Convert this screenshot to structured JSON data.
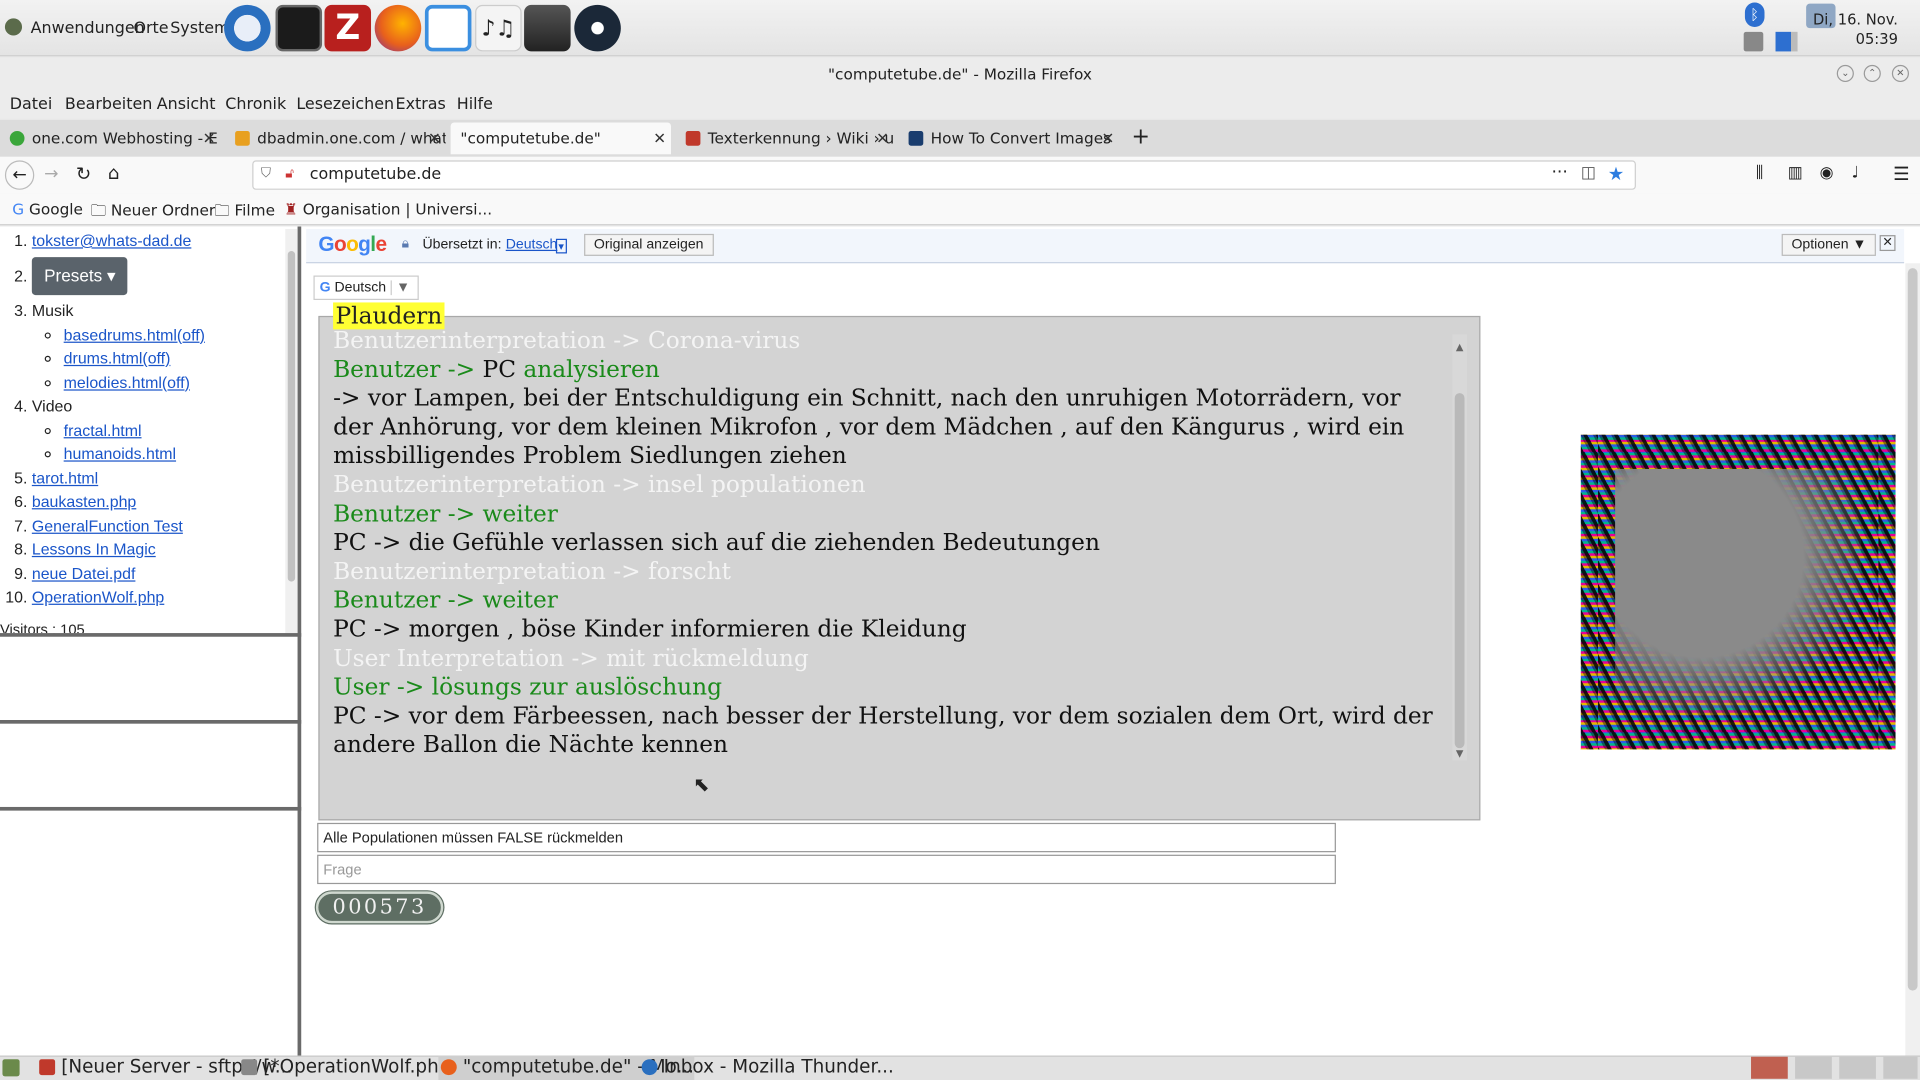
{
  "desktop_panel": {
    "menus": [
      "Anwendungen",
      "Orte",
      "System"
    ],
    "launchers": [
      "thunderbird-icon",
      "terminal-icon",
      "filezilla-icon",
      "firefox-icon",
      "media-player-icon",
      "music-notes-icon",
      "game-icon",
      "steam-icon"
    ],
    "clock_date": "Di, 16. Nov.",
    "clock_time": "05:39"
  },
  "window": {
    "title": "\"computetube.de\" - Mozilla Firefox"
  },
  "menubar": [
    "Datei",
    "Bearbeiten",
    "Ansicht",
    "Chronik",
    "Lesezeichen",
    "Extras",
    "Hilfe"
  ],
  "tabs": [
    {
      "label": "one.com Webhosting - E",
      "color": "#3aa63a"
    },
    {
      "label": "dbadmin.one.com / what",
      "color": "#e8a020"
    },
    {
      "label": "\"computetube.de\"",
      "color": ""
    },
    {
      "label": "Texterkennung › Wiki › ul",
      "color": "#c0392b"
    },
    {
      "label": "How To Convert Images",
      "color": "#1a3d6e"
    }
  ],
  "address": {
    "url": "computetube.de"
  },
  "bookmarks": [
    "Google",
    "Neuer Ordner",
    "Filme",
    "Organisation | Universi..."
  ],
  "sidebar": {
    "items": {
      "i1": "tokster@whats-dad.de",
      "presets": "Presets",
      "musik": "Musik",
      "basedrums": "basedrums.html(off)",
      "drums": "drums.html(off)",
      "melodies": "melodies.html(off)",
      "video": "Video",
      "fractal": "fractal.html",
      "humanoids": "humanoids.html",
      "tarot": "tarot.html",
      "baukasten": "baukasten.php",
      "generalfunction": "GeneralFunction Test",
      "lessons": "Lessons In Magic",
      "neuedatei": "neue Datei.pdf",
      "operationwolf": "OperationWolf.php"
    },
    "visitors": "Visitors : 105"
  },
  "translate_bar": {
    "translated_to_label": "Übersetzt in:",
    "language": "Deutsch",
    "show_original": "Original anzeigen",
    "options": "Optionen ▼",
    "lang_select": "Deutsch"
  },
  "chat": {
    "title": "Plaudern",
    "lines": {
      "l0": "Benutzerinterpretation -> Corona-virus",
      "l1a": "Benutzer -> ",
      "l1b": "PC",
      "l1c": " analysieren",
      "l2": "-> vor Lampen, bei der Entschuldigung ein Schnitt, nach den unruhigen Motorrädern, vor der Anhörung, vor dem kleinen Mikrofon , vor dem Mädchen , auf den Kängurus , wird ein missbilligendes Problem Siedlungen ziehen",
      "l3": "Benutzerinterpretation -> insel populationen",
      "l4": "Benutzer -> weiter",
      "l5": "PC -> die Gefühle verlassen sich auf die ziehenden Bedeutungen",
      "l6": "Benutzerinterpretation -> forscht",
      "l7": "Benutzer -> weiter",
      "l8": "PC -> morgen , böse Kinder informieren die Kleidung",
      "l9": "User Interpretation -> mit rückmeldung",
      "l10": "User -> lösungs zur auslöschung",
      "l11": "PC -> vor dem Färbeessen, nach besser der Herstellung, vor dem sozialen dem Ort, wird der andere Ballon die Nächte kennen"
    }
  },
  "inputs": {
    "populations_value": "Alle Populationen müssen FALSE rückmelden",
    "question_placeholder": "Frage"
  },
  "counter": "000573",
  "taskbar": [
    {
      "label": "[Neuer Server - sftp://w...",
      "color": "#c0392b"
    },
    {
      "label": "[*OperationWolf.php (/t...",
      "color": "#888888"
    },
    {
      "label": "\"computetube.de\" - Mo...",
      "color": "#e8601c"
    },
    {
      "label": "Inbox - Mozilla Thunder...",
      "color": "#2a6fbf"
    }
  ]
}
